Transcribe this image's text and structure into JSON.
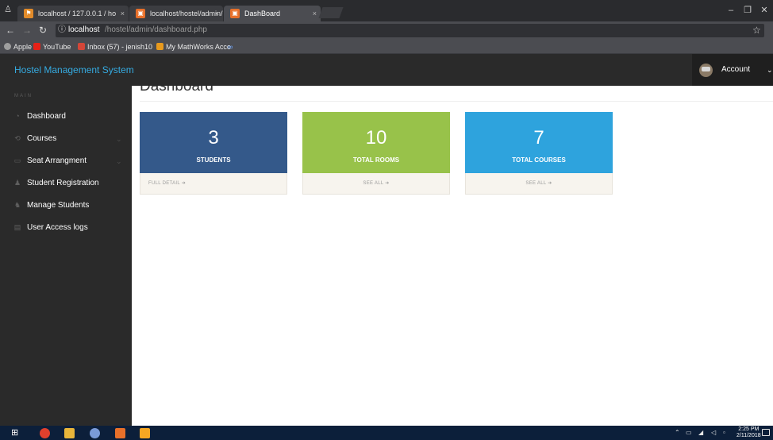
{
  "browser": {
    "tabs": [
      {
        "label": "localhost / 127.0.0.1 / ho",
        "close": "×"
      },
      {
        "label": "localhost/hostel/admin/",
        "close": "×"
      },
      {
        "label": "DashBoard",
        "close": "×"
      }
    ],
    "url_host": "localhost",
    "url_path": "/hostel/admin/dashboard.php",
    "bookmarks": [
      "Apple",
      "YouTube",
      "Inbox (57) - jenish10",
      "My MathWorks Acco",
      "∞"
    ]
  },
  "app": {
    "brand": "Hostel Management System",
    "account_label": "Account"
  },
  "sidebar": {
    "heading": "MAIN",
    "items": [
      {
        "label": "Dashboard",
        "icon": "dashboard-icon",
        "has_submenu": false
      },
      {
        "label": "Courses",
        "icon": "courses-icon",
        "has_submenu": true
      },
      {
        "label": "Seat Arrangment",
        "icon": "monitor-icon",
        "has_submenu": true
      },
      {
        "label": "Student Registration",
        "icon": "user-icon",
        "has_submenu": false
      },
      {
        "label": "Manage Students",
        "icon": "users-icon",
        "has_submenu": false
      },
      {
        "label": "User Access logs",
        "icon": "file-icon",
        "has_submenu": false
      }
    ]
  },
  "main": {
    "title": "Dashboard",
    "cards": [
      {
        "value": "3",
        "label": "STUDENTS",
        "link": "FULL DETAIL",
        "color": "#34598a"
      },
      {
        "value": "10",
        "label": "TOTAL ROOMS",
        "link": "SEE ALL",
        "color": "#98c24a"
      },
      {
        "value": "7",
        "label": "TOTAL COURSES",
        "link": "SEE ALL",
        "color": "#2ea3dd"
      }
    ]
  },
  "taskbar": {
    "time": "2:25 PM",
    "date": "2/11/2018"
  },
  "colors": {
    "brand": "#35aae0",
    "sidebar_bg": "#2a2a2a",
    "taskbar_bg": "#0c1f3a"
  }
}
